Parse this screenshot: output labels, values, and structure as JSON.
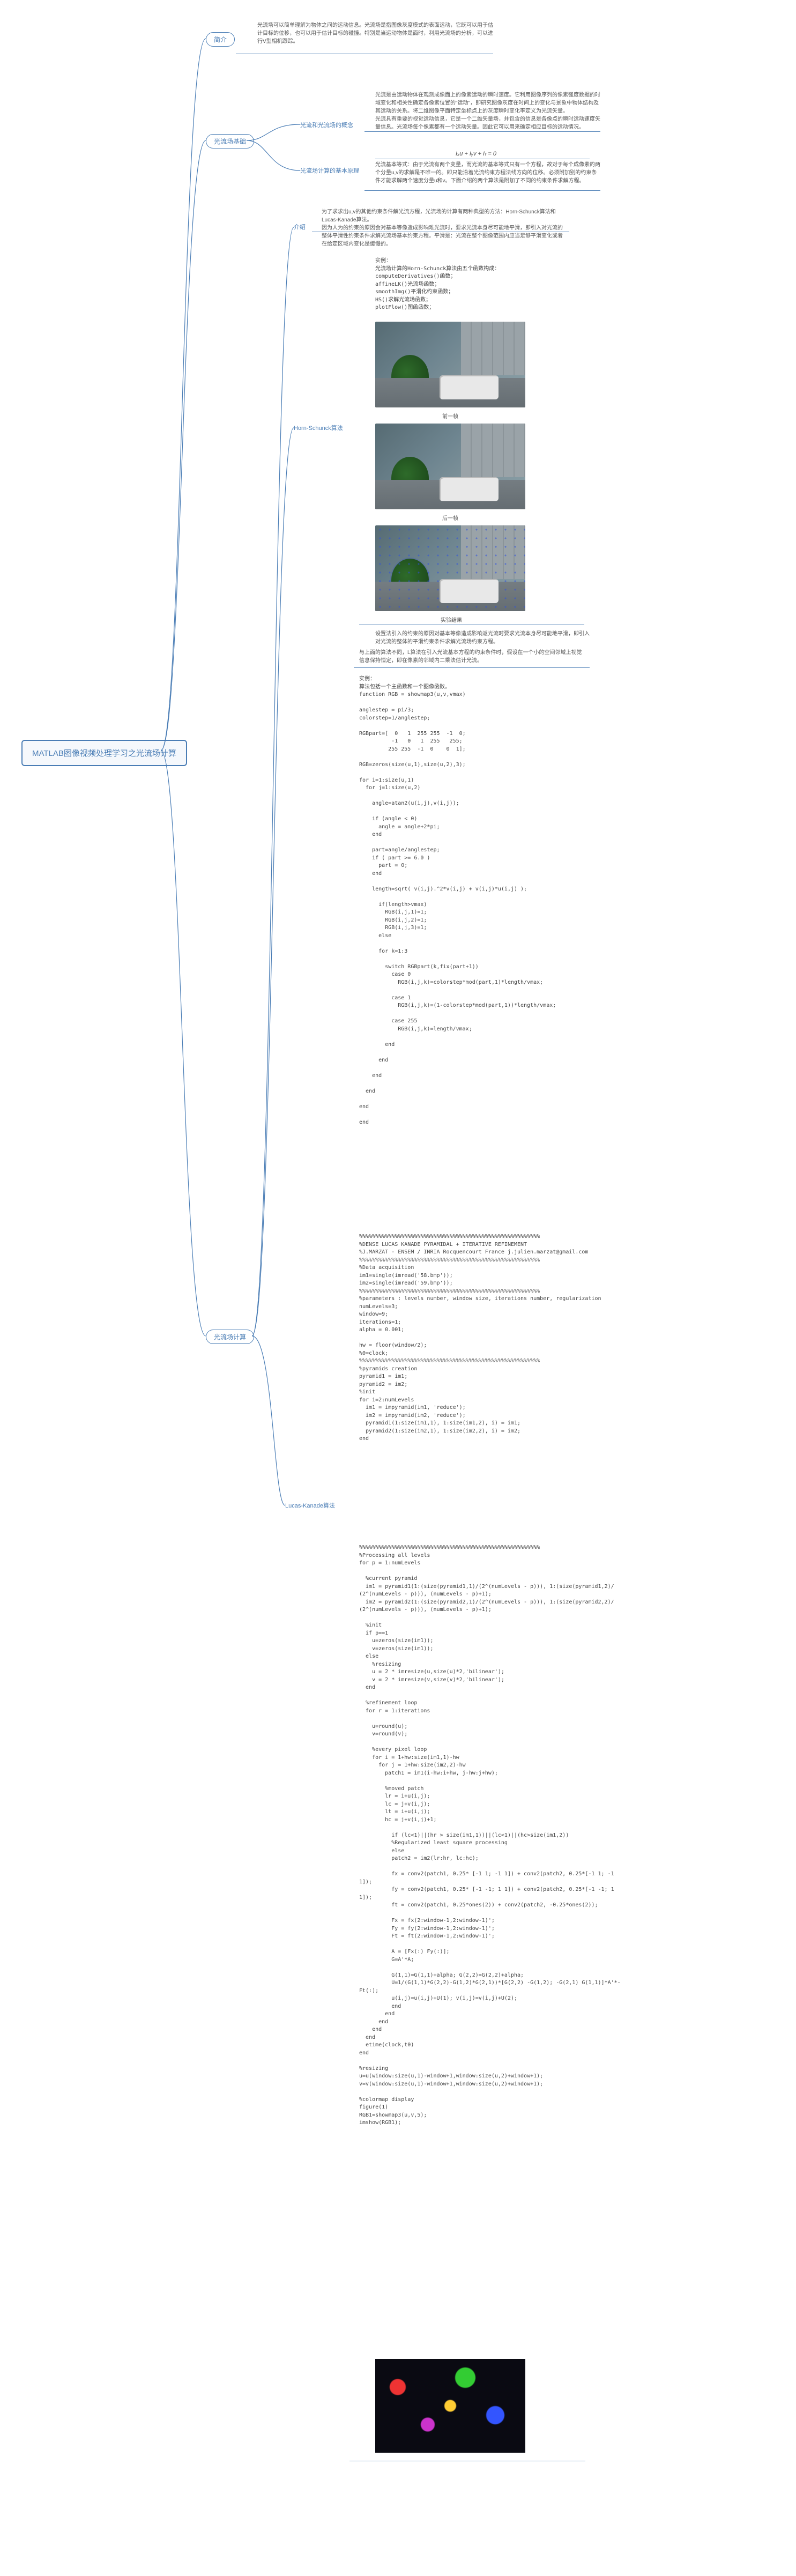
{
  "root": "MATLAB图像视频处理学习之光流场计算",
  "watermark": "",
  "n_intro": "简介",
  "n_basics": "光流场基础",
  "n_calc": "光流场计算",
  "intro_text": "光流场可以简单理解为物体之间的运动信息。光流场是指图像灰度模式的表面运动，它既可以用于估计目标的位移，也可以用于估计目标的碰撞。特别是当运动物体是面时，利用光流场的分析，可以进行V型相机跟踪。",
  "n_concept": "光流和光流场的概念",
  "concept_text": "光流是由运动物体在观测成像面上的像素运动的瞬时速度。它利用图像序列的像素强度数据的时域变化和相关性确定各像素位置的\"运动\"，即研究图像灰度在时间上的变化与景象中物体结构及其运动的关系。将二维图像平面特定坐标点上的灰度瞬时变化率定义为光流矢量。\n光流具有重要的视觉运动信息，它是一个二维矢量场，并包含的信息是各像点的瞬时运动速度矢量信息。光流场每个像素都有一个运动矢量。因此它可以用来确定相应目标的运动情况。",
  "n_principle": "光流场计算的基本原理",
  "principle_text": "光流基本等式：由于光流有两个变量，而光流的基本等式只有一个方程，故对于每个成像素的两个分量u,v的求解是不唯一的。即只能沿着光流约束方程法线方向的位移。必须附加别的约束条件才能求解两个速度分量u和v。下面介绍的两个算法是附加了不同的约束条件求解方程。",
  "formula": "Iₓu + Iᵧv + Iₜ = 0",
  "n_calc_intro": "介绍",
  "calc_intro_text": "为了求求出u,v的其他约束条件解光流方程，光流场的计算有两种典型的方法：Horn-Schunck算法和Lucas-Kanade算法。\n因为人为的约束的原因会对基本等像造成影响难光流时，要求光流本身尽可能地平滑，即引入对光流的整体平滑性约束条件求解光流场基本约束方程。平滑是：光流在整个图像范围内应当足够平滑变化或者在给定区域内变化是缓慢的。",
  "n_hs": "Horn-Schunck算法",
  "hs_code": "实例：\n光流场计算的Horn-Schunck算法由五个函数构成：\ncomputeDerivatives()函数；\naffineLK()光流场函数；\nsmoothImg()平滑化约束函数；\nHS()求解光流场函数；\nplotFlow()图函函数；",
  "hs_cap1": "前一帧",
  "hs_cap2": "后一帧",
  "hs_cap3": "实验结果",
  "hs_note": "设置法引入的约束的原因对基本等像造成影响返光流时要求光流本身尽可能地平滑，即引入对光流的整体的平滑约束条件求解光流场约束方程。",
  "n_lk": "Lucas-Kanade算法",
  "lk_intro": "与上面的算法不同，L算法在引入光流基本方程的约束条件时，假设在一个小的空间邻域上视觉信息保持恒定，即在像素的邻域内二乘法估计光流。",
  "lk_code_a": "实例：\n算法包括一个主函数和一个图像函数。\nfunction RGB = showmap3(u,v,vmax)\n\nanglestep = pi/3;\ncolorstep=1/anglestep;\n\nRGBpart=[  0   1  255 255  -1  0;\n          -1   0   1  255   255;\n         255 255  -1  0    0  1];\n\nRGB=zeros(size(u,1),size(u,2),3);\n\nfor i=1:size(u,1)\n  for j=1:size(u,2)\n\n    angle=atan2(u(i,j),v(i,j));\n\n    if (angle < 0)\n      angle = angle+2*pi;\n    end\n\n    part=angle/anglestep;\n    if ( part >= 6.0 )\n      part = 0;\n    end\n\n    length=sqrt( v(i,j).^2*v(i,j) + v(i,j)*u(i,j) );\n\n      if(length>vmax)\n        RGB(i,j,1)=1;\n        RGB(i,j,2)=1;\n        RGB(i,j,3)=1;\n      else\n\n      for k=1:3\n\n        switch RGBpart(k,fix(part+1))\n          case 0\n            RGB(i,j,k)=colorstep*mod(part,1)*length/vmax;\n\n          case 1\n            RGB(i,j,k)=(1-colorstep*mod(part,1))*length/vmax;\n\n          case 255\n            RGB(i,j,k)=length/vmax;\n\n        end\n\n      end\n\n    end\n\n  end\n\nend\n\nend",
  "lk_code_b": "%%%%%%%%%%%%%%%%%%%%%%%%%%%%%%%%%%%%%%%%%%%%%%%%%%%%%%%%\n%DENSE LUCAS KANADE PYRAMIDAL + ITERATIVE REFINEMENT\n%J.MARZAT - ENSEM / INRIA Rocquencourt France j.julien.marzat@gmail.com\n%%%%%%%%%%%%%%%%%%%%%%%%%%%%%%%%%%%%%%%%%%%%%%%%%%%%%%%%\n%Data acquisition\nim1=single(imread('58.bmp'));\nim2=single(imread('59.bmp'));\n%%%%%%%%%%%%%%%%%%%%%%%%%%%%%%%%%%%%%%%%%%%%%%%%%%%%%%%%\n%parameters : levels number, window size, iterations number, regularization\nnumLevels=3;\nwindow=9;\niterations=1;\nalpha = 0.001;\n\nhw = floor(window/2);\n%0=clock;\n%%%%%%%%%%%%%%%%%%%%%%%%%%%%%%%%%%%%%%%%%%%%%%%%%%%%%%%%\n%pyramids creation\npyramid1 = im1;\npyramid2 = im2;\n%init\nfor i=2:numLevels\n  im1 = impyramid(im1, 'reduce');\n  im2 = impyramid(im2, 'reduce');\n  pyramid1(1:size(im1,1), 1:size(im1,2), i) = im1;\n  pyramid2(1:size(im2,1), 1:size(im2,2), i) = im2;\nend",
  "lk_code_c": "%%%%%%%%%%%%%%%%%%%%%%%%%%%%%%%%%%%%%%%%%%%%%%%%%%%%%%%%\n%Processing all levels\nfor p = 1:numLevels\n\n  %current pyramid\n  im1 = pyramid1(1:(size(pyramid1,1)/(2^(numLevels - p))), 1:(size(pyramid1,2)/\n(2^(numLevels - p))), (numLevels - p)+1);\n  im2 = pyramid2(1:(size(pyramid2,1)/(2^(numLevels - p))), 1:(size(pyramid2,2)/\n(2^(numLevels - p))), (numLevels - p)+1);\n\n  %init\n  if p==1\n    u=zeros(size(im1));\n    v=zeros(size(im1));\n  else\n    %resizing\n    u = 2 * imresize(u,size(u)*2,'bilinear');\n    v = 2 * imresize(v,size(v)*2,'bilinear');\n  end\n\n  %refinement loop\n  for r = 1:iterations\n\n    u=round(u);\n    v=round(v);\n\n    %every pixel loop\n    for i = 1+hw:size(im1,1)-hw\n      for j = 1+hw:size(im2,2)-hw\n        patch1 = im1(i-hw:i+hw, j-hw:j+hw);\n\n        %moved patch\n        lr = i+u(i,j);\n        lc = j+v(i,j);\n        lt = i+u(i,j);\n        hc = j+v(i,j)+1;\n\n          if (lc<1)||(hr > size(im1,1))||(lc<1)||(hc>size(im1,2))\n          %Regularized least square processing\n          else\n          patch2 = im2(lr:hr, lc:hc);\n\n          fx = conv2(patch1, 0.25* [-1 1; -1 1]) + conv2(patch2, 0.25*[-1 1; -1\n1]);\n          fy = conv2(patch1, 0.25* [-1 -1; 1 1]) + conv2(patch2, 0.25*[-1 -1; 1\n1]);\n          ft = conv2(patch1, 0.25*ones(2)) + conv2(patch2, -0.25*ones(2));\n\n          Fx = fx(2:window-1,2:window-1)';\n          Fy = fy(2:window-1,2:window-1)';\n          Ft = ft(2:window-1,2:window-1)';\n\n          A = [Fx(:) Fy(:)];\n          G=A'*A;\n\n          G(1,1)=G(1,1)+alpha; G(2,2)=G(2,2)+alpha;\n          U=1/(G(1,1)*G(2,2)-G(1,2)*G(2,1))*[G(2,2) -G(1,2); -G(2,1) G(1,1)]*A'*-\nFt(:);\n          u(i,j)=u(i,j)+U(1); v(i,j)=v(i,j)+U(2);\n          end\n        end\n      end\n    end\n  end\n  etime(clock,t0)\nend\n\n%resizing\nu=u(window:size(u,1)-window+1,window:size(u,2)+window+1);\nv=v(window:size(u,1)-window+1,window:size(u,2)+window+1);\n\n%colormap display\nfigure(1)\nRGB1=showmap3(u,v,5);\nimshow(RGB1);"
}
